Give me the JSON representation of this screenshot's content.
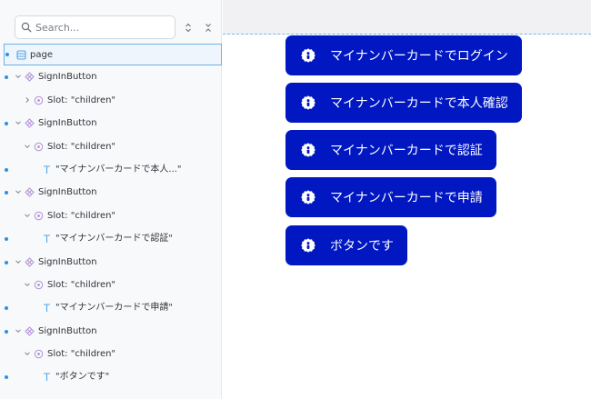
{
  "search": {
    "placeholder": "Search..."
  },
  "tree": {
    "page_label": "page",
    "items": [
      {
        "component": "SignInButton",
        "slot": "Slot: \"children\"",
        "text": ""
      },
      {
        "component": "SignInButton",
        "slot": "Slot: \"children\"",
        "text": "\"マイナンバーカードで本人...\""
      },
      {
        "component": "SignInButton",
        "slot": "Slot: \"children\"",
        "text": "\"マイナンバーカードで認証\""
      },
      {
        "component": "SignInButton",
        "slot": "Slot: \"children\"",
        "text": "\"マイナンバーカードで申請\""
      },
      {
        "component": "SignInButton",
        "slot": "Slot: \"children\"",
        "text": "\"ボタンです\""
      }
    ]
  },
  "canvas": {
    "buttons": [
      {
        "label": "マイナンバーカードでログイン"
      },
      {
        "label": "マイナンバーカードで本人確認"
      },
      {
        "label": "マイナンバーカードで認証"
      },
      {
        "label": "マイナンバーカードで申請"
      },
      {
        "label": "ボタンです"
      }
    ]
  },
  "colors": {
    "button_bg": "#0017c1",
    "selection": "#6ab3ea",
    "component_icon": "#b38fd8",
    "text_icon": "#55a8e6"
  },
  "icons": {
    "search": "search-icon",
    "sort": "sort-toggle-icon",
    "collapse": "collapse-all-icon",
    "page": "page-layout-icon",
    "component": "component-icon",
    "slot": "slot-icon",
    "text": "text-node-icon",
    "mynumber": "mynumber-card-icon"
  }
}
